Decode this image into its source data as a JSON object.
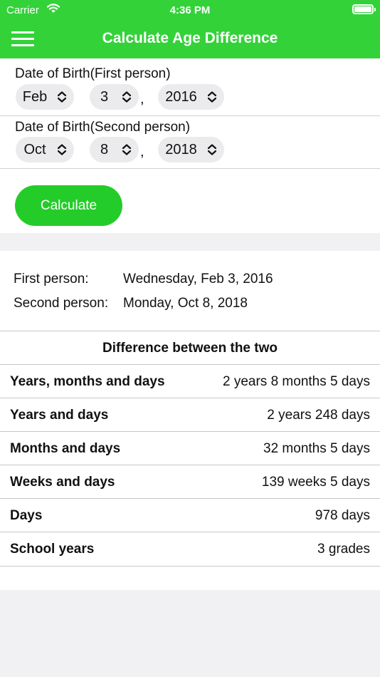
{
  "status": {
    "carrier": "Carrier",
    "time": "4:36 PM"
  },
  "header": {
    "title": "Calculate Age Difference"
  },
  "first": {
    "label": "Date of Birth(First person)",
    "month": "Feb",
    "day": "3",
    "year": "2016"
  },
  "second": {
    "label": "Date of Birth(Second person)",
    "month": "Oct",
    "day": "8",
    "year": "2018"
  },
  "comma": ",",
  "calculate_label": "Calculate",
  "summary": {
    "first_label": "First person:",
    "first_value": "Wednesday, Feb 3, 2016",
    "second_label": "Second person:",
    "second_value": "Monday, Oct 8, 2018"
  },
  "difference": {
    "header": "Difference between the two",
    "rows": [
      {
        "label": "Years, months and days",
        "value": "2 years 8 months 5 days"
      },
      {
        "label": "Years and days",
        "value": "2 years 248 days"
      },
      {
        "label": "Months and days",
        "value": "32 months 5 days"
      },
      {
        "label": "Weeks and days",
        "value": "139 weeks 5 days"
      },
      {
        "label": "Days",
        "value": "978 days"
      },
      {
        "label": "School years",
        "value": "3 grades"
      }
    ]
  },
  "colors": {
    "brand": "#33d239",
    "button": "#24cc2a",
    "picker_bg": "#ebebee",
    "page_bg": "#f1f1f4"
  }
}
